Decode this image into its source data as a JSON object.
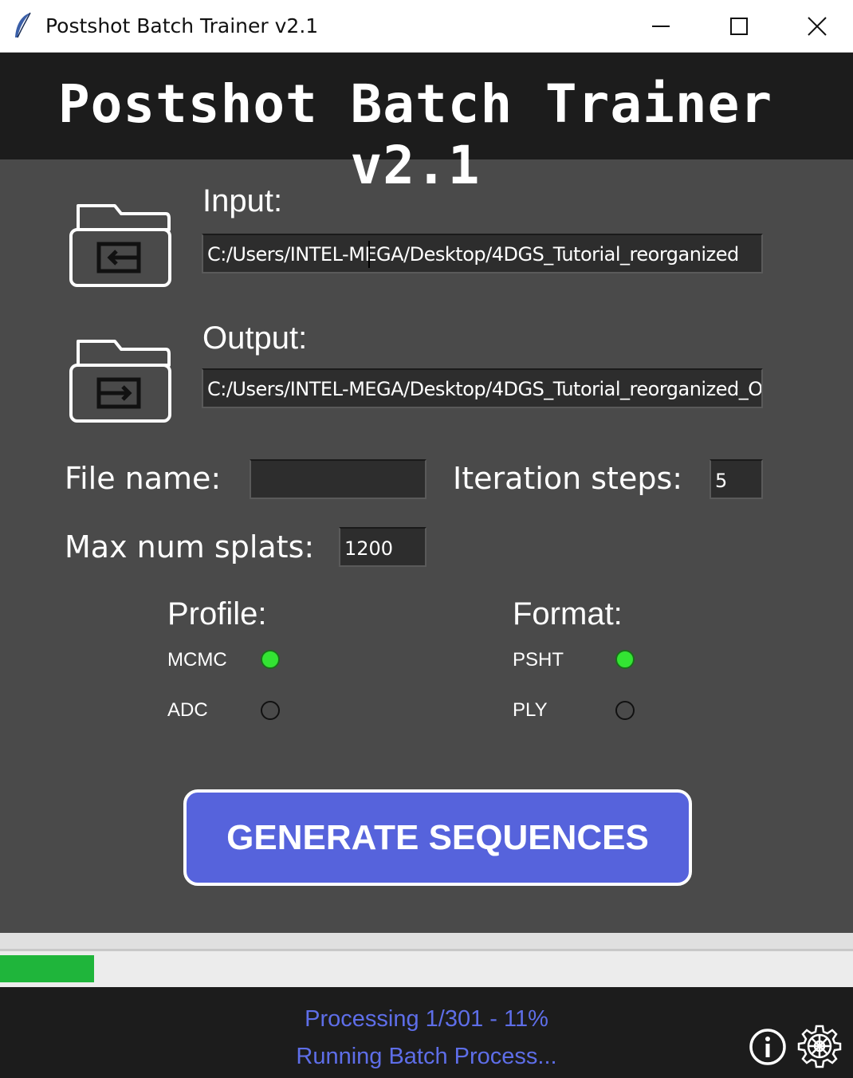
{
  "window": {
    "title": "Postshot Batch Trainer v2.1"
  },
  "header": {
    "title": "Postshot Batch Trainer v2.1"
  },
  "input": {
    "label": "Input:",
    "value": "C:/Users/INTEL-MEGA/Desktop/4DGS_Tutorial_reorganized"
  },
  "output": {
    "label": "Output:",
    "value": "C:/Users/INTEL-MEGA/Desktop/4DGS_Tutorial_reorganized_O"
  },
  "file_name": {
    "label": "File name:",
    "value": ""
  },
  "iteration_steps": {
    "label": "Iteration steps:",
    "value": "5"
  },
  "max_splats": {
    "label": "Max num splats:",
    "value": "1200"
  },
  "profile": {
    "label": "Profile:",
    "options": [
      {
        "label": "MCMC",
        "selected": true
      },
      {
        "label": "ADC",
        "selected": false
      }
    ]
  },
  "format": {
    "label": "Format:",
    "options": [
      {
        "label": "PSHT",
        "selected": true
      },
      {
        "label": "PLY",
        "selected": false
      }
    ]
  },
  "generate_button": {
    "label": "GENERATE SEQUENCES",
    "color": "#5663dc"
  },
  "progress": {
    "fraction": 0.11,
    "color": "#1fb53b"
  },
  "status": {
    "line1": "Processing 1/301 - 11%",
    "line2": "Running Batch Process...",
    "color": "#5e6ee8"
  },
  "icons": {
    "app": "feather-icon",
    "input_folder": "folder-import-icon",
    "output_folder": "folder-export-icon",
    "info": "info-icon",
    "settings": "gear-icon"
  }
}
